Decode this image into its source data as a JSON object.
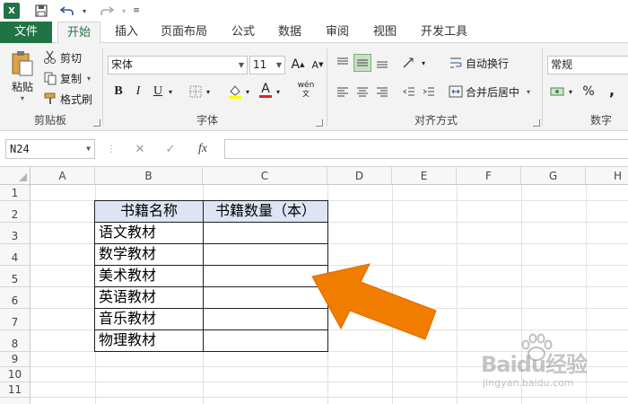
{
  "qat": {
    "logo_text": "X",
    "save_icon": "save-icon",
    "undo_icon": "undo-icon",
    "redo_icon": "redo-icon"
  },
  "tabs": [
    "文件",
    "开始",
    "插入",
    "页面布局",
    "公式",
    "数据",
    "审阅",
    "视图",
    "开发工具"
  ],
  "active_tab": "开始",
  "ribbon": {
    "clipboard": {
      "paste": "粘贴",
      "cut": "剪切",
      "copy": "复制",
      "format_painter": "格式刷",
      "label": "剪贴板"
    },
    "font": {
      "font_name": "宋体",
      "font_size": "11",
      "grow": "A",
      "shrink": "A",
      "bold": "B",
      "italic": "I",
      "underline": "U",
      "font_color": "A",
      "phonetic": "wén",
      "label": "字体"
    },
    "alignment": {
      "wrap_text": "自动换行",
      "merge_center": "合并后居中",
      "label": "对齐方式"
    },
    "number": {
      "format": "常规",
      "percent": "%",
      "comma": ",",
      "label": "数字"
    }
  },
  "formula_bar": {
    "name_box": "N24",
    "fx": "fx",
    "cancel": "✕",
    "enter": "✓",
    "value": ""
  },
  "columns": [
    "A",
    "B",
    "C",
    "D",
    "E",
    "F",
    "G",
    "H"
  ],
  "rows": [
    "1",
    "2",
    "3",
    "4",
    "5",
    "6",
    "7",
    "8",
    "9",
    "10",
    "11"
  ],
  "table": {
    "headers": [
      "书籍名称",
      "书籍数量（本）"
    ],
    "rows": [
      [
        "语文教材",
        ""
      ],
      [
        "数学教材",
        ""
      ],
      [
        "美术教材",
        ""
      ],
      [
        "英语教材",
        ""
      ],
      [
        "音乐教材",
        ""
      ],
      [
        "物理教材",
        ""
      ]
    ]
  },
  "colors": {
    "accent": "#217346",
    "header_fill": "#dde5f5",
    "arrow": "#f07c00"
  },
  "watermark": {
    "text": "Baidu经验",
    "url": "jingyan.baidu.com"
  }
}
